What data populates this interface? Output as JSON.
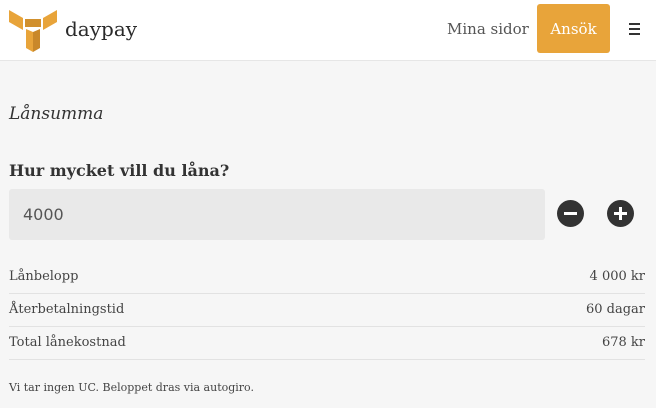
{
  "header": {
    "brand": "daypay",
    "nav_link": "Mina sidor",
    "apply_button": "Ansök",
    "accent_color": "#e8a43a"
  },
  "icons": {
    "logo": "daypay-logo-icon",
    "menu": "hamburger-menu-icon",
    "minus": "minus-circle-icon",
    "plus": "plus-circle-icon"
  },
  "loan": {
    "section_title": "Lånsumma",
    "question": "Hur mycket vill du låna?",
    "amount_value": "4000"
  },
  "summary": [
    {
      "label": "Lånbelopp",
      "value": "4 000 kr"
    },
    {
      "label": "Återbetalningstid",
      "value": "60 dagar"
    },
    {
      "label": "Total lånekostnad",
      "value": "678 kr"
    }
  ],
  "note": "Vi tar ingen UC. Beloppet dras via autogiro."
}
